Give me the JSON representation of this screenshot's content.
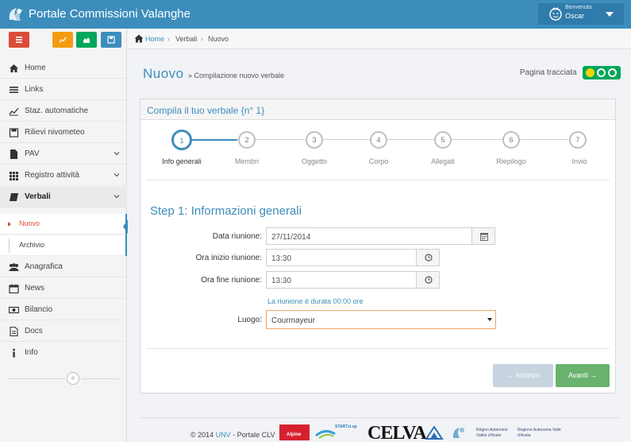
{
  "app": {
    "title": "Portale Commissioni Valanghe"
  },
  "user": {
    "greeting": "Benvenuto",
    "name": "Oscar"
  },
  "quick_buttons": [
    {
      "icon": "menu-icon",
      "color": "#dd4b39"
    },
    {
      "icon": "line-chart-icon",
      "color": "#f39c12"
    },
    {
      "icon": "area-chart-icon",
      "color": "#00a65a"
    },
    {
      "icon": "save-icon",
      "color": "#3c8dbc"
    }
  ],
  "sidebar": {
    "items": [
      {
        "label": "Home",
        "icon": "home-icon"
      },
      {
        "label": "Links",
        "icon": "bars-icon"
      },
      {
        "label": "Staz. automatiche",
        "icon": "line-chart-icon"
      },
      {
        "label": "Rilievi nivometeo",
        "icon": "save-icon"
      },
      {
        "label": "PAV",
        "icon": "file-icon"
      },
      {
        "label": "Registro attività",
        "icon": "grid-icon"
      },
      {
        "label": "Verbali",
        "icon": "edit-icon"
      },
      {
        "label": "Anagrafica",
        "icon": "users-icon"
      },
      {
        "label": "News",
        "icon": "calendar-icon"
      },
      {
        "label": "Bilancio",
        "icon": "money-icon"
      },
      {
        "label": "Docs",
        "icon": "document-icon"
      },
      {
        "label": "Info",
        "icon": "info-icon"
      }
    ],
    "subitems": [
      {
        "label": "Nuovo"
      },
      {
        "label": "Archivio"
      }
    ],
    "collapse_symbol": "«"
  },
  "breadcrumb": {
    "home": "Home",
    "sep": "›",
    "verbali": "Verbali",
    "nuovo": "Nuovo"
  },
  "page": {
    "title": "Nuovo",
    "subtitle": "» Compilazione nuovo verbale",
    "tracked_label": "Pagina tracciata"
  },
  "form": {
    "title": "Compila il tuo verbale {n° 1}",
    "steps": [
      {
        "num": "1",
        "label": "Info generali"
      },
      {
        "num": "2",
        "label": "Membri"
      },
      {
        "num": "3",
        "label": "Oggetto"
      },
      {
        "num": "4",
        "label": "Corpo"
      },
      {
        "num": "5",
        "label": "Allegati"
      },
      {
        "num": "6",
        "label": "Riepilogo"
      },
      {
        "num": "7",
        "label": "Invio"
      }
    ],
    "active_step": 1,
    "step_heading": "Step 1: Informazioni generali",
    "fields": {
      "data_label": "Data riunione:",
      "data_value": "27/11/2014",
      "ora_inizio_label": "Ora inizio riunione:",
      "ora_inizio_value": "13:30",
      "ora_fine_label": "Ora fine riunione:",
      "ora_fine_value": "13:30",
      "duration_text": "La riunione è durata 00:00 ore",
      "luogo_label": "Luogo:",
      "luogo_value": "Courmayeur"
    },
    "buttons": {
      "back": "← Indietro",
      "next": "Avanti →"
    }
  },
  "footer": {
    "prefix": "© 2014 ",
    "org": "UNV",
    "suffix": " - Portale CLV",
    "logos": {
      "alpine": "Alpine",
      "start": "START.it.up",
      "celva": "CELVA",
      "region1": "Région Autonome Vallée d'Aoste",
      "region2": "Regione Autonoma Valle d'Aosta"
    }
  }
}
